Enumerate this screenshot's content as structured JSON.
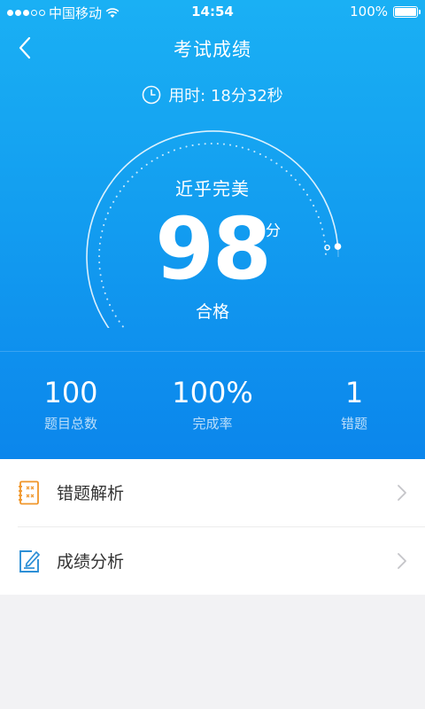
{
  "status_bar": {
    "carrier": "中国移动",
    "time": "14:54",
    "battery": "100%",
    "signal_bars_filled": 3,
    "signal_bars_total": 5
  },
  "nav": {
    "title": "考试成绩",
    "back_icon": "chevron-left-icon"
  },
  "time_used": {
    "label": "用时: 18分32秒",
    "icon": "clock-icon"
  },
  "result": {
    "rating": "近乎完美",
    "score": "98",
    "unit": "分",
    "verdict": "合格",
    "score_fraction": 0.98
  },
  "stats": [
    {
      "value": "100",
      "label": "题目总数"
    },
    {
      "value": "100%",
      "label": "完成率"
    },
    {
      "value": "1",
      "label": "错题"
    }
  ],
  "menu": [
    {
      "label": "错题解析",
      "icon": "mistake-notebook-icon"
    },
    {
      "label": "成绩分析",
      "icon": "edit-note-icon"
    }
  ],
  "colors": {
    "hero_top": "#1ab0f4",
    "hero_bottom": "#0b86ec",
    "mistake_icon": "#f0962a",
    "analysis_icon": "#2d8fd6"
  }
}
